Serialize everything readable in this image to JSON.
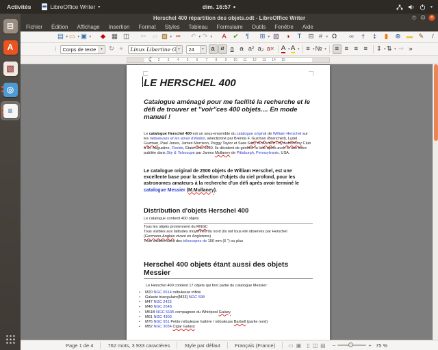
{
  "topbar": {
    "activities": "Activités",
    "app_name": "LibreOffice Writer",
    "clock": "dim. 16:57"
  },
  "window": {
    "title": "Herschel 400 répartition des objets.odt - LibreOffice Writer"
  },
  "menubar": [
    "Fichier",
    "Édition",
    "Affichage",
    "Insertion",
    "Format",
    "Styles",
    "Tableau",
    "Formulaire",
    "Outils",
    "Fenêtre",
    "Aide"
  ],
  "launcher": [
    {
      "name": "files-icon",
      "g": "⊟",
      "c": "#f4f0ec",
      "bg": "#9a8c80"
    },
    {
      "name": "ubuntu-software-icon",
      "g": "A",
      "c": "#ffffff",
      "bg": "#e95420"
    },
    {
      "name": "photos-icon",
      "g": "▧",
      "c": "#a04848",
      "bg": "#efe9e1"
    },
    {
      "name": "chromium-icon",
      "g": "◎",
      "c": "#eaf4fc",
      "bg": "#4e9bd4",
      "running": true
    },
    {
      "name": "libreoffice-writer-icon",
      "g": "≡",
      "c": "#2a6099",
      "bg": "#f7f6f4",
      "running": true,
      "on": true
    }
  ],
  "toolbar1": [
    {
      "name": "new-document-button",
      "g": "▤",
      "c": "#3a6ea5",
      "dd": true
    },
    {
      "name": "open-button",
      "g": "▭",
      "c": "#c17d11",
      "dd": true
    },
    {
      "name": "save-button",
      "g": "▣",
      "c": "#3a6ea5",
      "dd": true
    },
    {
      "sep": true
    },
    {
      "name": "export-pdf-button",
      "g": "◆",
      "c": "#cc0000"
    },
    {
      "name": "print-button",
      "g": "▦",
      "c": "#555555"
    },
    {
      "name": "print-preview-button",
      "g": "◫",
      "c": "#555555"
    },
    {
      "sep": true
    },
    {
      "name": "cut-button",
      "g": "✂",
      "c": "#b9b5af",
      "dim": true
    },
    {
      "name": "copy-button",
      "g": "▱",
      "c": "#b9b5af",
      "dim": true
    },
    {
      "name": "paste-button",
      "g": "▨",
      "c": "#8f5902",
      "dd": true
    },
    {
      "name": "clone-formatting-button",
      "g": "✑",
      "c": "#cc4411"
    },
    {
      "sep": true
    },
    {
      "name": "undo-button",
      "g": "↶",
      "c": "#b0aca6",
      "dd": true,
      "dim": true
    },
    {
      "name": "redo-button",
      "g": "↷",
      "c": "#b0aca6",
      "dd": true,
      "dim": true
    },
    {
      "sep": true
    },
    {
      "name": "spelling-button",
      "g": "A",
      "c": "#cc0000"
    },
    {
      "name": "auto-spellcheck-button",
      "g": "✔",
      "c": "#4e9a06"
    },
    {
      "name": "formatting-marks-button",
      "g": "¶",
      "c": "#4a6ea9"
    },
    {
      "sep": true
    },
    {
      "name": "insert-table-button",
      "g": "⊞",
      "c": "#4a6ea9",
      "dd": true
    },
    {
      "name": "insert-image-button",
      "g": "▧",
      "c": "#75507b"
    },
    {
      "name": "insert-chart-button",
      "g": "◑",
      "c": "#cc0000"
    },
    {
      "name": "insert-textbox-button",
      "g": "T",
      "c": "#204a87"
    },
    {
      "name": "page-break-button",
      "g": "⊟",
      "c": "#555555"
    },
    {
      "name": "insert-field-button",
      "g": "#",
      "c": "#666666",
      "dd": true
    },
    {
      "name": "special-character-button",
      "g": "Ω",
      "c": "#222222"
    },
    {
      "sep": true
    },
    {
      "name": "hyperlink-button",
      "g": "∞",
      "c": "#666666"
    },
    {
      "name": "insert-footnote-button",
      "g": "†",
      "c": "#204a87"
    },
    {
      "name": "insert-endnote-button",
      "g": "‡",
      "c": "#204a87"
    },
    {
      "name": "bookmark-button",
      "g": "▮",
      "c": "#f57900"
    },
    {
      "name": "cross-reference-button",
      "g": "⊕",
      "c": "#204a87"
    },
    {
      "name": "insert-comment-button",
      "g": "▬",
      "c": "#e9c94a"
    },
    {
      "name": "track-changes-button",
      "g": "✎",
      "c": "#8f5902"
    },
    {
      "name": "insert-line-button",
      "g": "/",
      "c": "#555555"
    },
    {
      "name": "toolbar-overflow-button",
      "g": "»",
      "c": "#333333"
    }
  ],
  "toolbar2": {
    "style_combo": "Corps de texte",
    "font_combo": "Linux Libertine G",
    "size_combo": "24",
    "extra": [
      {
        "name": "update-style-button",
        "g": "↻",
        "c": "#888888"
      },
      {
        "name": "new-style-button",
        "g": "+",
        "c": "#888888"
      }
    ],
    "buttons": [
      {
        "name": "bold-button",
        "g": "a",
        "cls": "fw",
        "on": true
      },
      {
        "name": "italic-button",
        "g": "a",
        "cls": "fi",
        "on": true
      },
      {
        "name": "underline-button",
        "g": "a",
        "cls": "fu"
      },
      {
        "name": "strikethrough-button",
        "g": "a",
        "cls": "fs"
      },
      {
        "name": "superscript-button",
        "g": "a²"
      },
      {
        "name": "subscript-button",
        "g": "a₂"
      },
      {
        "name": "clear-formatting-button",
        "g": "a×",
        "c": "#aa3333"
      },
      {
        "sep": true
      },
      {
        "name": "font-color-button",
        "g": "A",
        "cls": "fcol",
        "dd": true
      },
      {
        "name": "highlight-color-button",
        "g": "A",
        "cls": "fhl",
        "dd": true
      },
      {
        "sep": true
      },
      {
        "name": "bullet-list-button",
        "g": "≡",
        "dd": true
      },
      {
        "name": "numbered-list-button",
        "g": "№",
        "dd": true
      },
      {
        "sep": true
      },
      {
        "name": "align-left-button",
        "g": "≡",
        "on": true
      },
      {
        "name": "align-center-button",
        "g": "≡"
      },
      {
        "name": "align-right-button",
        "g": "≡"
      },
      {
        "name": "justify-button",
        "g": "≡"
      },
      {
        "sep": true
      },
      {
        "name": "line-spacing-button",
        "g": "⇕",
        "dd": true
      },
      {
        "name": "paragraph-spacing-button",
        "g": "⇅",
        "dd": true
      },
      {
        "name": "indent-button",
        "g": "⇒",
        "dim": true
      },
      {
        "name": "toolbar-overflow-button",
        "g": "»",
        "c": "#333333"
      }
    ]
  },
  "ruler": {
    "numbers": [
      "1",
      "2",
      "3",
      "4",
      "5",
      "6",
      "7",
      "8",
      "9",
      "10",
      "11",
      "12",
      "13",
      "14",
      "15"
    ]
  },
  "doc": {
    "title": "LE HERSCHEL 400",
    "subtitle": "Catalogue aménagé pour me facilité la recherche et le défi de trouver et ''voir''ces 400 objets.... En mode manuel !",
    "para1": [
      {
        "t": "Le ",
        "s": "plain"
      },
      {
        "t": "catalogue Herschel 400",
        "s": "bold"
      },
      {
        "t": " est un sous-ensemble du ",
        "s": "plain"
      },
      {
        "t": "catalogue original",
        "s": "link"
      },
      {
        "t": " de ",
        "s": "plain"
      },
      {
        "t": "William Herschel",
        "s": "link"
      },
      {
        "t": " sur les ",
        "s": "plain"
      },
      {
        "t": "nébuleuses et les amas d'étoiles",
        "s": "link-italic"
      },
      {
        "t": ", sélectionné par Brenda F. ",
        "s": "plain"
      },
      {
        "t": "Guzman",
        "s": "sq"
      },
      {
        "t": " (",
        "s": "plain"
      },
      {
        "t": "Branchett",
        "s": "sq"
      },
      {
        "t": "), ",
        "s": "plain"
      },
      {
        "t": "Lydel",
        "s": "sq"
      },
      {
        "t": " ",
        "s": "plain"
      },
      {
        "t": "Guzman",
        "s": "sq"
      },
      {
        "t": ", Paul Jones, James ",
        "s": "plain"
      },
      {
        "t": "Morrison",
        "s": "sq"
      },
      {
        "t": ", Peggy Taylor et Sara ",
        "s": "plain"
      },
      {
        "t": "Saey",
        "s": "sq"
      },
      {
        "t": " du ",
        "s": "plain"
      },
      {
        "t": "Ancient",
        "s": "sq"
      },
      {
        "t": " City ",
        "s": "plain"
      },
      {
        "t": "Astronomy",
        "s": "sq"
      },
      {
        "t": " Club à St. Augustine, ",
        "s": "plain"
      },
      {
        "t": "Floride",
        "s": "link"
      },
      {
        "t": ", États-Unis 1980. Ils décident de générer la liste après avoir lu une lettre publiée dans ",
        "s": "plain"
      },
      {
        "t": "Sky & Telescope",
        "s": "link-italic"
      },
      {
        "t": " par James ",
        "s": "plain"
      },
      {
        "t": "Mullaney",
        "s": "sq"
      },
      {
        "t": " de ",
        "s": "plain"
      },
      {
        "t": "Pittsburgh",
        "s": "link"
      },
      {
        "t": ", ",
        "s": "plain"
      },
      {
        "t": "Pennsylvanie",
        "s": "link"
      },
      {
        "t": ", USA.",
        "s": "plain"
      }
    ],
    "para2": [
      {
        "t": "Le catalogue original de 2500 objets de William Herschel, est une excellente base pour la sélection d'objets du ciel profond, pour les astronomes amateurs à la recherche d'un défi après avoir terminé le ",
        "s": "bold"
      },
      {
        "t": "catalogue Messier",
        "s": "link-bold"
      },
      {
        "t": " (",
        "s": "bold"
      },
      {
        "t": "M.Mullaney",
        "s": "bold-sq"
      },
      {
        "t": ").",
        "s": "bold"
      }
    ],
    "h2a": "Distribution d'objets Herschel 400",
    "dist_first": "Le catalogue contient 400 objets",
    "dist_lines": [
      {
        "segs": [
          {
            "t": "Tous les objets proviennent du ",
            "s": "plain"
          },
          {
            "t": "RNGC",
            "s": "sq"
          }
        ]
      },
      {
        "segs": [
          {
            "t": "Tous visibles aux latitudes moyennes du nord (ils ont tous été observés par Herschel",
            "s": "plain"
          }
        ]
      },
      {
        "segs": [
          {
            "t": "(",
            "s": "plain"
          },
          {
            "t": "Germano-Anglais",
            "s": "sq"
          },
          {
            "t": " vivant en Angleterre)",
            "s": "plain"
          }
        ]
      },
      {
        "segs": [
          {
            "t": "Tous visibles dans des ",
            "s": "plain"
          },
          {
            "t": "télescopes de",
            "s": "link"
          },
          {
            "t": " 150 mm (6 \") ou plus",
            "s": "plain"
          }
        ]
      }
    ],
    "h2b": "Herschel 400 objets étant aussi des objets Messier",
    "intro": "Le Herschel 400 contient 17 objets qui font partie du catalogue Messier:",
    "bullets": [
      {
        "segs": [
          {
            "t": "M20 ",
            "s": "plain"
          },
          {
            "t": "NGC 6514",
            "s": "link"
          },
          {
            "t": " nébuleuse trifide",
            "s": "plain"
          }
        ]
      },
      {
        "segs": [
          {
            "t": "Galaxie triangulaire[M33] ",
            "s": "plain"
          },
          {
            "t": "NGC 598",
            "s": "link"
          }
        ]
      },
      {
        "segs": [
          {
            "t": "M47 ",
            "s": "plain"
          },
          {
            "t": "NGC 2422",
            "s": "link"
          }
        ]
      },
      {
        "segs": [
          {
            "t": "M48 ",
            "s": "plain"
          },
          {
            "t": "NGC 2548",
            "s": "link"
          }
        ]
      },
      {
        "segs": [
          {
            "t": "M51B ",
            "s": "plain"
          },
          {
            "t": "NGC 5195",
            "s": "link"
          },
          {
            "t": " compagnon du Whirlpool ",
            "s": "plain"
          },
          {
            "t": "Galaxy",
            "s": "sq"
          }
        ]
      },
      {
        "segs": [
          {
            "t": "M61 ",
            "s": "plain"
          },
          {
            "t": "NGC 4303",
            "s": "link"
          }
        ]
      },
      {
        "segs": [
          {
            "t": "M76 ",
            "s": "plain"
          },
          {
            "t": "NGC 651",
            "s": "link"
          },
          {
            "t": " Petite nébuleuse haltère / nébuleuse ",
            "s": "plain"
          },
          {
            "t": "Barbell",
            "s": "sq"
          },
          {
            "t": " (partie nord)",
            "s": "plain"
          }
        ]
      },
      {
        "segs": [
          {
            "t": "M82 ",
            "s": "plain"
          },
          {
            "t": "NGC 3034",
            "s": "link"
          },
          {
            "t": " ",
            "s": "plain"
          },
          {
            "t": "Cigar Galaxy",
            "s": "sq"
          }
        ]
      }
    ]
  },
  "statusbar": {
    "page": "Page 1 de 4",
    "words": "762 mots, 3 933 caractères",
    "style": "Style par défaut",
    "language": "Français (France)",
    "zoom": "75 %"
  }
}
